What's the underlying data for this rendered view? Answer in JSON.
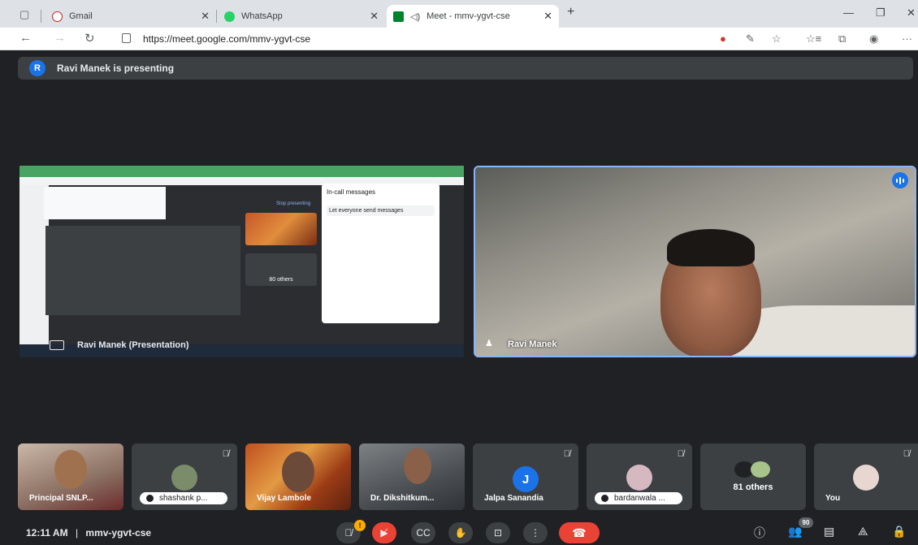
{
  "browser": {
    "tabs": [
      {
        "label": "Gmail"
      },
      {
        "label": "WhatsApp"
      },
      {
        "label": "Meet - mmv-ygvt-cse"
      }
    ],
    "url": "https://meet.google.com/mmv-ygvt-cse"
  },
  "meet": {
    "presenting_banner": "Ravi Manek is presenting",
    "presenter_initial": "R",
    "presentation_label": "Ravi Manek (Presentation)",
    "speaker_label": "Ravi Manek",
    "shared_screen": {
      "panel_title": "In-call messages",
      "panel_toggle_label": "Let everyone send messages",
      "others_label": "80 others",
      "stop_label": "Stop presenting"
    },
    "participants": [
      {
        "name": "Principal SNLP...",
        "style": "video"
      },
      {
        "name": "shashank p...",
        "style": "pill"
      },
      {
        "name": "Vijay Lambole",
        "style": "video"
      },
      {
        "name": "Dr. Dikshitkum...",
        "style": "video"
      },
      {
        "name": "Jalpa Sanandia",
        "initial": "J",
        "style": "initial"
      },
      {
        "name": "bardanwala ...",
        "style": "pill"
      },
      {
        "name": "81 others",
        "style": "others"
      },
      {
        "name": "You",
        "style": "self"
      }
    ],
    "time": "12:11 AM",
    "meeting_code": "mmv-ygvt-cse",
    "participant_count": "90",
    "raise_hand_count": "!",
    "colors": {
      "accent": "#1a73e8",
      "danger": "#ea4335",
      "surface": "#3c4043",
      "background": "#202124"
    }
  }
}
